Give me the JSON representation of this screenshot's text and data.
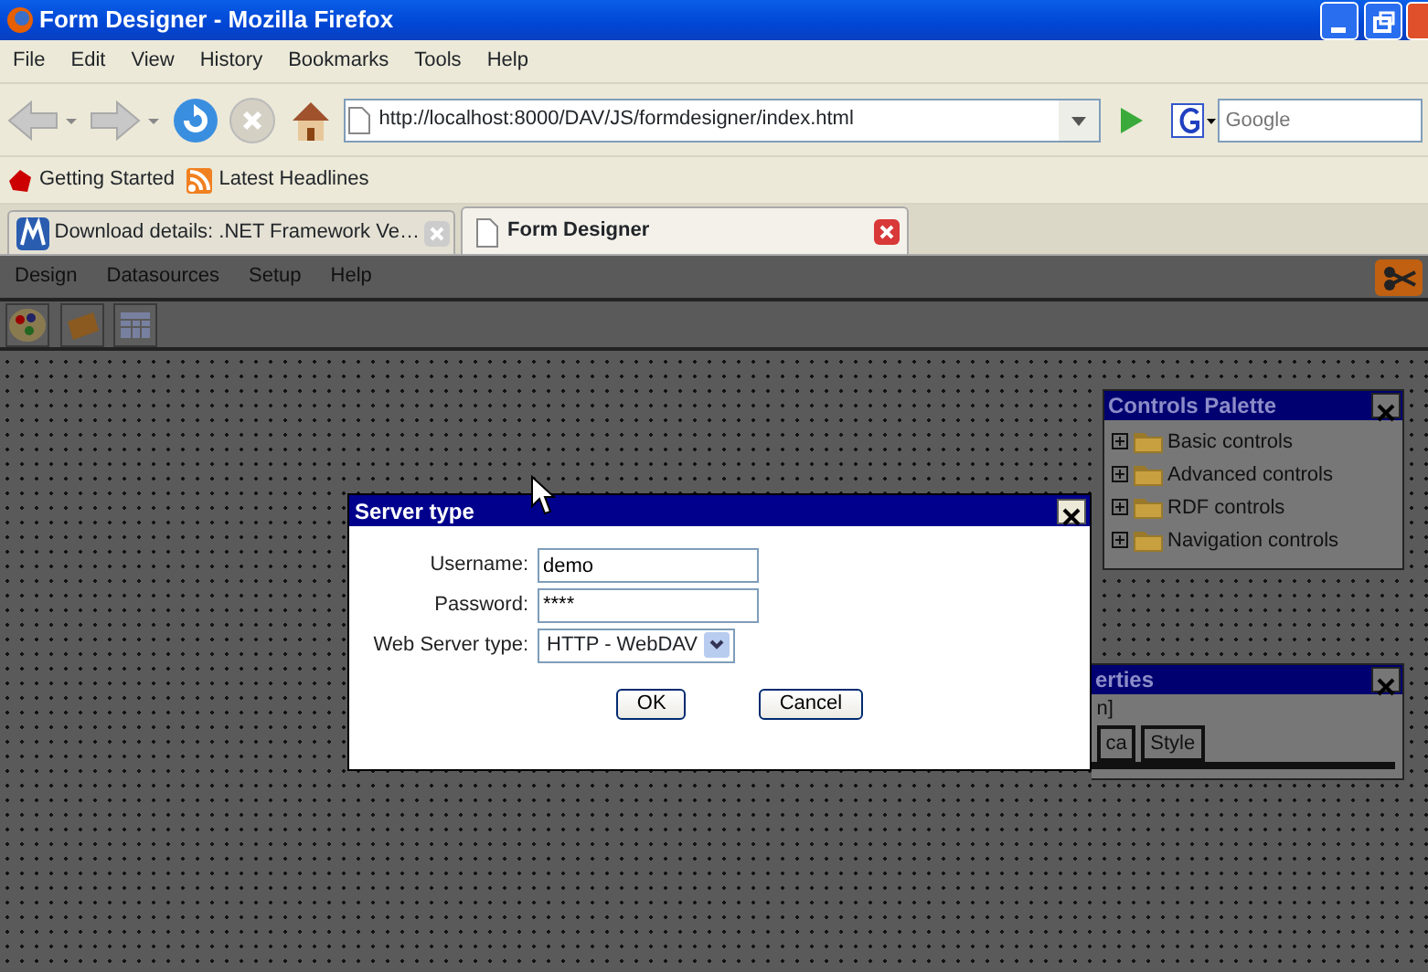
{
  "window": {
    "title": "Form Designer - Mozilla Firefox"
  },
  "menu": [
    "File",
    "Edit",
    "View",
    "History",
    "Bookmarks",
    "Tools",
    "Help"
  ],
  "address": {
    "url": "http://localhost:8000/DAV/JS/formdesigner/index.html"
  },
  "search": {
    "placeholder": "Google"
  },
  "bookmarks": [
    "Getting Started",
    "Latest Headlines"
  ],
  "tabs": [
    {
      "label": "Download details: .NET Framework Ve…",
      "selected": false
    },
    {
      "label": "Form Designer",
      "selected": true
    }
  ],
  "app_menu": [
    "Design",
    "Datasources",
    "Setup",
    "Help"
  ],
  "controls_palette": {
    "title": "Controls Palette",
    "items": [
      {
        "label": "Basic controls",
        "expanded": false
      },
      {
        "label": "Advanced controls",
        "expanded": false
      },
      {
        "label": "RDF controls",
        "expanded": false
      },
      {
        "label": "Navigation controls",
        "expanded": false
      }
    ]
  },
  "properties_panel": {
    "title": "erties",
    "line": "n]",
    "tabs": [
      "ca",
      "Style"
    ]
  },
  "dialog": {
    "title": "Server type",
    "fields": [
      {
        "kind": "text",
        "label": "Username:",
        "value": "demo"
      },
      {
        "kind": "text",
        "label": "Password:",
        "value": "****"
      },
      {
        "kind": "select",
        "label": "Web Server type:",
        "value": "HTTP - WebDAV"
      }
    ],
    "buttons": [
      "OK",
      "Cancel"
    ]
  }
}
